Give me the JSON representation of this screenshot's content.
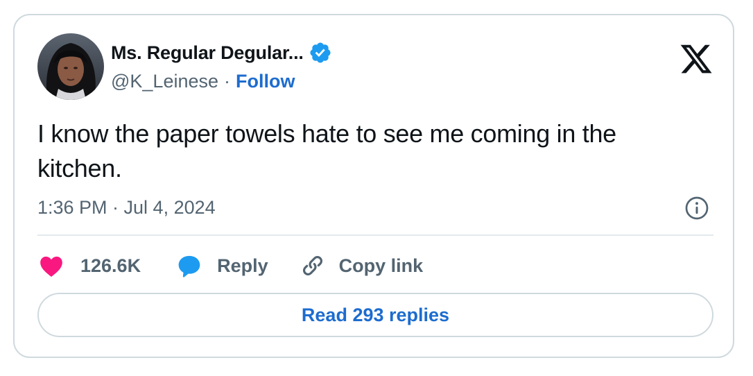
{
  "author": {
    "display_name": "Ms. Regular Degular...",
    "handle": "@K_Leinese",
    "verified": true,
    "avatar_icon": "profile-photo"
  },
  "follow": {
    "separator": "·",
    "label": "Follow"
  },
  "brand": {
    "logo_icon": "x-logo-icon"
  },
  "tweet": {
    "text": "I know the paper towels hate to see me coming in the kitchen.",
    "timestamp": "1:36 PM · Jul 4, 2024"
  },
  "actions": {
    "like_count": "126.6K",
    "reply_label": "Reply",
    "copy_link_label": "Copy link"
  },
  "replies": {
    "read_label": "Read 293 replies"
  },
  "colors": {
    "accent": "#1d6ccf",
    "verified": "#1d9bf0",
    "like": "#f91880",
    "text_primary": "#0f1419",
    "text_secondary": "#536471",
    "border": "#cfd9de"
  }
}
